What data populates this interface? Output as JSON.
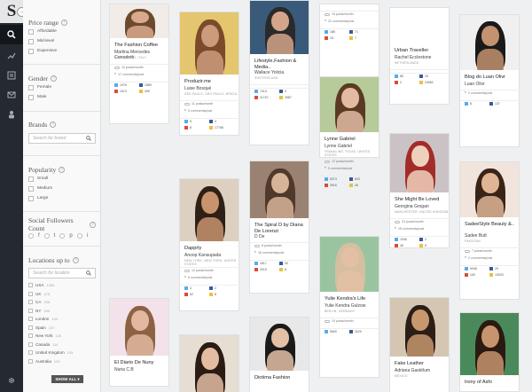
{
  "app": {
    "logo": "S",
    "nav_arrow": "→"
  },
  "rail": {
    "icons": [
      "search-icon",
      "chart-icon",
      "list-icon",
      "mail-icon",
      "person-icon"
    ],
    "bottom_icon": "gear-icon"
  },
  "filters": {
    "price": {
      "title": "Price range",
      "options": [
        "Affordable",
        "Mid-level",
        "Expensive"
      ]
    },
    "gender": {
      "title": "Gender",
      "options": [
        "Female",
        "Male"
      ]
    },
    "brands": {
      "title": "Brands",
      "placeholder": "Search for brand"
    },
    "popularity": {
      "title": "Popularity",
      "options": [
        "Small",
        "Medium",
        "Large"
      ]
    },
    "social": {
      "title": "Social Followers Count",
      "icons": [
        "f",
        "t",
        "p",
        "g",
        "i"
      ]
    },
    "locations": {
      "title": "Locations up to",
      "placeholder": "Search for location",
      "items": [
        {
          "name": "USA",
          "count": "1265"
        },
        {
          "name": "UK",
          "count": "475"
        },
        {
          "name": "CA",
          "count": "296"
        },
        {
          "name": "NY",
          "count": "265"
        },
        {
          "name": "London",
          "count": "154"
        },
        {
          "name": "Spain",
          "count": "137"
        },
        {
          "name": "New York",
          "count": "125"
        },
        {
          "name": "Canada",
          "count": "114"
        },
        {
          "name": "United Kingdom",
          "count": "105"
        },
        {
          "name": "Australia",
          "count": "102"
        }
      ]
    },
    "show_all": "SHOW ALL ▾"
  },
  "cards": [
    {
      "title": "The Fashion Coffee",
      "author": "Martina Mercedes Corradetti",
      "location": "ROME, LAZIO, ITALY",
      "posts": "10 posts/month",
      "comments": "17 comments/post",
      "stats": [
        "1976",
        "1889",
        "1013",
        "490"
      ],
      "colors": {
        "bg": "#f2ece8",
        "skin": "#d9a98c",
        "hair": "#6b4a2e"
      }
    },
    {
      "title": "El Diario De Nuny",
      "author": "Nuria C.B",
      "location": "",
      "colors": {
        "bg": "#f3e2ea",
        "skin": "#e2b9a0",
        "hair": "#8d6244"
      }
    },
    {
      "title": "Produzir.me",
      "author": "Luise Bosqué",
      "location": "SÃO PAULO, SÃO PAULO, BRAZIL",
      "posts": "11 posts/month",
      "comments": "5 comments/post",
      "stats": [
        "5",
        "4",
        "8",
        "17768"
      ],
      "colors": {
        "bg": "#e3c66d",
        "skin": "#cc9a7c",
        "hair": "#7a4a2a"
      }
    },
    {
      "title": "Dapprly",
      "author": "Anoop Kansupada",
      "location": "NEW YORK, NEW YORK, UNITED STATES",
      "posts": "12 posts/month",
      "comments": "6 comments/post",
      "stats": [
        "4",
        "2",
        "62",
        "8"
      ],
      "colors": {
        "bg": "#ddd0c0",
        "skin": "#c8946e",
        "hair": "#2e2016"
      }
    },
    {
      "title": "",
      "author": "",
      "location": "",
      "colors": {
        "bg": "#e6ddd3",
        "skin": "#e3bca2",
        "hair": "#2a1c14"
      }
    },
    {
      "title": "Lifestyle,Fashion & Media..",
      "author": "Wallace Yolicia",
      "location": "SWITZERLAND",
      "posts": "",
      "comments": "",
      "stats": [
        "7413",
        "9",
        "11710",
        "2687"
      ],
      "colors": {
        "bg": "#3a5a7a",
        "skin": "#d4a58a",
        "hair": "#2a2a2a"
      }
    },
    {
      "title": "The Spiral D by Diana De Lorenzi",
      "author": "D De",
      "location": "",
      "posts": "8 posts/month",
      "comments": "16 comments/post",
      "stats": [
        "1817",
        "30",
        "2015",
        "8"
      ],
      "colors": {
        "bg": "#9a8272",
        "skin": "#d7b399",
        "hair": "#50382a"
      }
    },
    {
      "title": "Diotima Fashion",
      "author": "",
      "location": "",
      "colors": {
        "bg": "#e8e8e8",
        "skin": "#e4c0a6",
        "hair": "#1a1a1a"
      }
    },
    {
      "title": "",
      "author": "",
      "location": "",
      "posts": "15 posts/month",
      "comments": "22 comments/post",
      "stats": [
        "185",
        "71",
        "15",
        "7"
      ],
      "colors": {
        "bg": "#fff",
        "skin": "#fff",
        "hair": "#fff"
      }
    },
    {
      "title": "Lynne Gabriel",
      "author": "Lynne Gabriel",
      "location": "FRANKLINS, TEXAS, UNITED STATES",
      "posts": "12 posts/month",
      "comments": "5 comments/post",
      "stats": [
        "5374",
        "603",
        "3916",
        "46"
      ],
      "colors": {
        "bg": "#b6ca9a",
        "skin": "#e2bba2",
        "hair": "#5a3a22"
      }
    },
    {
      "title": "Yulie Kendra's Life",
      "author": "Yulie Kendra Gulzow",
      "location": "BERLIN, GERMANY",
      "posts": "10 posts/month",
      "comments": "",
      "stats": [
        "5650",
        "3220",
        "",
        "",
        ""
      ],
      "colors": {
        "bg": "#9ac4a0",
        "skin": "#e3c0a4",
        "hair": "#d5bfa0"
      }
    },
    {
      "title": "Urban Traveller",
      "author": "Rachel Ecclestone",
      "location": "NETHERLANDS",
      "posts": "",
      "comments": "",
      "stats": [
        "86",
        "15",
        "2",
        "24962"
      ],
      "colors": {
        "bg": "#fff",
        "skin": "#fff",
        "hair": "#fff"
      }
    },
    {
      "title": "She Might Be Loved",
      "author": "Georgina Grogan",
      "location": "MANCHESTER, UNITED KINGDOM",
      "posts": "23 posts/month",
      "comments": "15 comments/post",
      "stats": [
        "1946",
        "2",
        "46",
        "8"
      ],
      "colors": {
        "bg": "#cbc2c6",
        "skin": "#eed1bd",
        "hair": "#a32c28"
      }
    },
    {
      "title": "Fake Leather",
      "author": "Adriana Gastélum",
      "location": "MEXICO",
      "colors": {
        "bg": "#d4c6b3",
        "skin": "#c7986e",
        "hair": "#2a1e16"
      }
    },
    {
      "title": "Blog do Luan Olivr",
      "author": "Luan Olivr",
      "location": "",
      "posts": "",
      "comments": "2 comments/post",
      "stats": [
        "8",
        "137"
      ],
      "colors": {
        "bg": "#f0f0f0",
        "skin": "#c3926f",
        "hair": "#1a1a1a"
      }
    },
    {
      "title": "SadeeStyle Beauty &..",
      "author": "Sadee Butt",
      "location": "PAKISTAN",
      "posts": "7 posts/month",
      "comments": "2 comments/post",
      "stats": [
        "5948",
        "29",
        "150",
        "10923"
      ],
      "colors": {
        "bg": "#f0e4dc",
        "skin": "#e0b596",
        "hair": "#3a2418"
      }
    },
    {
      "title": "Irony of Ashi",
      "author": "",
      "location": "",
      "colors": {
        "bg": "#4a8a5a",
        "skin": "#c6946e",
        "hair": "#2a1a12"
      }
    }
  ]
}
